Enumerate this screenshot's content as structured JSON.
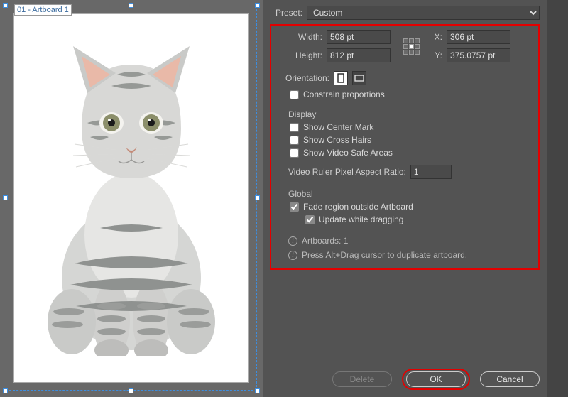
{
  "artboard_label": "01 - Artboard 1",
  "preset": {
    "label": "Preset:",
    "value": "Custom"
  },
  "width": {
    "label": "Width:",
    "value": "508 pt"
  },
  "height": {
    "label": "Height:",
    "value": "812 pt"
  },
  "x": {
    "label": "X:",
    "value": "306 pt"
  },
  "y": {
    "label": "Y:",
    "value": "375.0757 pt"
  },
  "orientation_label": "Orientation:",
  "constrain": {
    "label": "Constrain proportions",
    "checked": false
  },
  "display_title": "Display",
  "display": {
    "center_mark": {
      "label": "Show Center Mark",
      "checked": false
    },
    "cross_hairs": {
      "label": "Show Cross Hairs",
      "checked": false
    },
    "video_safe": {
      "label": "Show Video Safe Areas",
      "checked": false
    }
  },
  "video_ratio": {
    "label": "Video Ruler Pixel Aspect Ratio:",
    "value": "1"
  },
  "global_title": "Global",
  "global": {
    "fade": {
      "label": "Fade region outside Artboard",
      "checked": true
    },
    "update": {
      "label": "Update while dragging",
      "checked": true
    }
  },
  "info1": "Artboards: 1",
  "info2": "Press Alt+Drag cursor to duplicate artboard.",
  "buttons": {
    "delete": "Delete",
    "ok": "OK",
    "cancel": "Cancel"
  }
}
